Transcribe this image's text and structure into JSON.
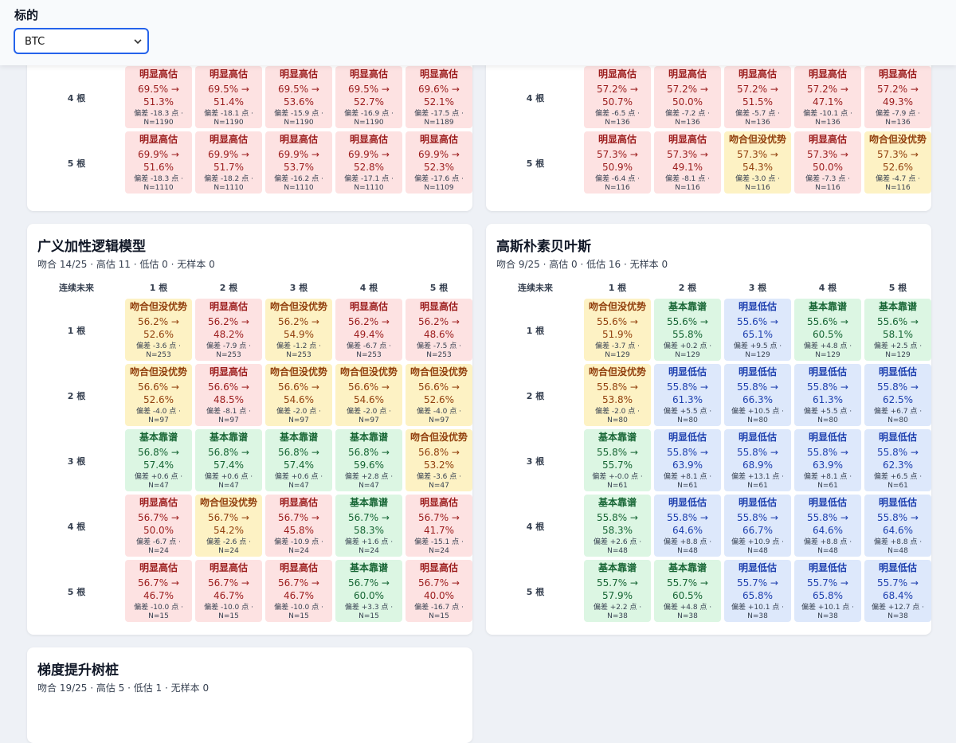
{
  "filter": {
    "label": "标的",
    "value": "BTC"
  },
  "cards": [
    {
      "title": "",
      "subtitle": "",
      "show_header": false,
      "col_header": "",
      "cols": [],
      "rows": [
        {
          "label": "4 根",
          "cells": [
            {
              "verdict": "明显高估",
              "a": "69.5% →",
              "b": "51.3%",
              "dev": "偏差 -18.3 点 ·",
              "n": "N=1190",
              "color": "red"
            },
            {
              "verdict": "明显高估",
              "a": "69.5% →",
              "b": "51.4%",
              "dev": "偏差 -18.1 点 ·",
              "n": "N=1190",
              "color": "red"
            },
            {
              "verdict": "明显高估",
              "a": "69.5% →",
              "b": "53.6%",
              "dev": "偏差 -15.9 点 ·",
              "n": "N=1190",
              "color": "red"
            },
            {
              "verdict": "明显高估",
              "a": "69.5% →",
              "b": "52.7%",
              "dev": "偏差 -16.9 点 ·",
              "n": "N=1190",
              "color": "red"
            },
            {
              "verdict": "明显高估",
              "a": "69.6% →",
              "b": "52.1%",
              "dev": "偏差 -17.5 点 ·",
              "n": "N=1189",
              "color": "red"
            }
          ]
        },
        {
          "label": "5 根",
          "cells": [
            {
              "verdict": "明显高估",
              "a": "69.9% →",
              "b": "51.6%",
              "dev": "偏差 -18.3 点 ·",
              "n": "N=1110",
              "color": "red"
            },
            {
              "verdict": "明显高估",
              "a": "69.9% →",
              "b": "51.7%",
              "dev": "偏差 -18.2 点 ·",
              "n": "N=1110",
              "color": "red"
            },
            {
              "verdict": "明显高估",
              "a": "69.9% →",
              "b": "53.7%",
              "dev": "偏差 -16.2 点 ·",
              "n": "N=1110",
              "color": "red"
            },
            {
              "verdict": "明显高估",
              "a": "69.9% →",
              "b": "52.8%",
              "dev": "偏差 -17.1 点 ·",
              "n": "N=1110",
              "color": "red"
            },
            {
              "verdict": "明显高估",
              "a": "69.9% →",
              "b": "52.3%",
              "dev": "偏差 -17.6 点 ·",
              "n": "N=1109",
              "color": "red"
            }
          ]
        }
      ]
    },
    {
      "title": "",
      "subtitle": "",
      "show_header": false,
      "col_header": "",
      "cols": [],
      "rows": [
        {
          "label": "4 根",
          "cells": [
            {
              "verdict": "明显高估",
              "a": "57.2% →",
              "b": "50.7%",
              "dev": "偏差 -6.5 点 ·",
              "n": "N=136",
              "color": "red"
            },
            {
              "verdict": "明显高估",
              "a": "57.2% →",
              "b": "50.0%",
              "dev": "偏差 -7.2 点 ·",
              "n": "N=136",
              "color": "red"
            },
            {
              "verdict": "明显高估",
              "a": "57.2% →",
              "b": "51.5%",
              "dev": "偏差 -5.7 点 ·",
              "n": "N=136",
              "color": "red"
            },
            {
              "verdict": "明显高估",
              "a": "57.2% →",
              "b": "47.1%",
              "dev": "偏差 -10.1 点 ·",
              "n": "N=136",
              "color": "red"
            },
            {
              "verdict": "明显高估",
              "a": "57.2% →",
              "b": "49.3%",
              "dev": "偏差 -7.9 点 ·",
              "n": "N=136",
              "color": "red"
            }
          ]
        },
        {
          "label": "5 根",
          "cells": [
            {
              "verdict": "明显高估",
              "a": "57.3% →",
              "b": "50.9%",
              "dev": "偏差 -6.4 点 ·",
              "n": "N=116",
              "color": "red"
            },
            {
              "verdict": "明显高估",
              "a": "57.3% →",
              "b": "49.1%",
              "dev": "偏差 -8.1 点 ·",
              "n": "N=116",
              "color": "red"
            },
            {
              "verdict": "吻合但没优势",
              "a": "57.3% →",
              "b": "54.3%",
              "dev": "偏差 -3.0 点 ·",
              "n": "N=116",
              "color": "yel"
            },
            {
              "verdict": "明显高估",
              "a": "57.3% →",
              "b": "50.0%",
              "dev": "偏差 -7.3 点 ·",
              "n": "N=116",
              "color": "red"
            },
            {
              "verdict": "吻合但没优势",
              "a": "57.3% →",
              "b": "52.6%",
              "dev": "偏差 -4.7 点 ·",
              "n": "N=116",
              "color": "yel"
            }
          ]
        }
      ]
    },
    {
      "title": "广义加性逻辑模型",
      "subtitle": "吻合 14/25 · 高估 11 · 低估 0 · 无样本 0",
      "show_header": true,
      "col_header": "连续未来",
      "cols": [
        "1 根",
        "2 根",
        "3 根",
        "4 根",
        "5 根"
      ],
      "rows": [
        {
          "label": "1 根",
          "cells": [
            {
              "verdict": "吻合但没优势",
              "a": "56.2% →",
              "b": "52.6%",
              "dev": "偏差 -3.6 点 ·",
              "n": "N=253",
              "color": "yel"
            },
            {
              "verdict": "明显高估",
              "a": "56.2% →",
              "b": "48.2%",
              "dev": "偏差 -7.9 点 ·",
              "n": "N=253",
              "color": "red"
            },
            {
              "verdict": "吻合但没优势",
              "a": "56.2% →",
              "b": "54.9%",
              "dev": "偏差 -1.2 点 ·",
              "n": "N=253",
              "color": "yel"
            },
            {
              "verdict": "明显高估",
              "a": "56.2% →",
              "b": "49.4%",
              "dev": "偏差 -6.7 点 ·",
              "n": "N=253",
              "color": "red"
            },
            {
              "verdict": "明显高估",
              "a": "56.2% →",
              "b": "48.6%",
              "dev": "偏差 -7.5 点 ·",
              "n": "N=253",
              "color": "red"
            }
          ]
        },
        {
          "label": "2 根",
          "cells": [
            {
              "verdict": "吻合但没优势",
              "a": "56.6% →",
              "b": "52.6%",
              "dev": "偏差 -4.0 点 ·",
              "n": "N=97",
              "color": "yel"
            },
            {
              "verdict": "明显高估",
              "a": "56.6% →",
              "b": "48.5%",
              "dev": "偏差 -8.1 点 ·",
              "n": "N=97",
              "color": "red"
            },
            {
              "verdict": "吻合但没优势",
              "a": "56.6% →",
              "b": "54.6%",
              "dev": "偏差 -2.0 点 ·",
              "n": "N=97",
              "color": "yel"
            },
            {
              "verdict": "吻合但没优势",
              "a": "56.6% →",
              "b": "54.6%",
              "dev": "偏差 -2.0 点 ·",
              "n": "N=97",
              "color": "yel"
            },
            {
              "verdict": "吻合但没优势",
              "a": "56.6% →",
              "b": "52.6%",
              "dev": "偏差 -4.0 点 ·",
              "n": "N=97",
              "color": "yel"
            }
          ]
        },
        {
          "label": "3 根",
          "cells": [
            {
              "verdict": "基本靠谱",
              "a": "56.8% →",
              "b": "57.4%",
              "dev": "偏差 +0.6 点 ·",
              "n": "N=47",
              "color": "grn"
            },
            {
              "verdict": "基本靠谱",
              "a": "56.8% →",
              "b": "57.4%",
              "dev": "偏差 +0.6 点 ·",
              "n": "N=47",
              "color": "grn"
            },
            {
              "verdict": "基本靠谱",
              "a": "56.8% →",
              "b": "57.4%",
              "dev": "偏差 +0.6 点 ·",
              "n": "N=47",
              "color": "grn"
            },
            {
              "verdict": "基本靠谱",
              "a": "56.8% →",
              "b": "59.6%",
              "dev": "偏差 +2.8 点 ·",
              "n": "N=47",
              "color": "grn"
            },
            {
              "verdict": "吻合但没优势",
              "a": "56.8% →",
              "b": "53.2%",
              "dev": "偏差 -3.6 点 ·",
              "n": "N=47",
              "color": "yel"
            }
          ]
        },
        {
          "label": "4 根",
          "cells": [
            {
              "verdict": "明显高估",
              "a": "56.7% →",
              "b": "50.0%",
              "dev": "偏差 -6.7 点 ·",
              "n": "N=24",
              "color": "red"
            },
            {
              "verdict": "吻合但没优势",
              "a": "56.7% →",
              "b": "54.2%",
              "dev": "偏差 -2.6 点 ·",
              "n": "N=24",
              "color": "yel"
            },
            {
              "verdict": "明显高估",
              "a": "56.7% →",
              "b": "45.8%",
              "dev": "偏差 -10.9 点 ·",
              "n": "N=24",
              "color": "red"
            },
            {
              "verdict": "基本靠谱",
              "a": "56.7% →",
              "b": "58.3%",
              "dev": "偏差 +1.6 点 ·",
              "n": "N=24",
              "color": "grn"
            },
            {
              "verdict": "明显高估",
              "a": "56.7% →",
              "b": "41.7%",
              "dev": "偏差 -15.1 点 ·",
              "n": "N=24",
              "color": "red"
            }
          ]
        },
        {
          "label": "5 根",
          "cells": [
            {
              "verdict": "明显高估",
              "a": "56.7% →",
              "b": "46.7%",
              "dev": "偏差 -10.0 点 ·",
              "n": "N=15",
              "color": "red"
            },
            {
              "verdict": "明显高估",
              "a": "56.7% →",
              "b": "46.7%",
              "dev": "偏差 -10.0 点 ·",
              "n": "N=15",
              "color": "red"
            },
            {
              "verdict": "明显高估",
              "a": "56.7% →",
              "b": "46.7%",
              "dev": "偏差 -10.0 点 ·",
              "n": "N=15",
              "color": "red"
            },
            {
              "verdict": "基本靠谱",
              "a": "56.7% →",
              "b": "60.0%",
              "dev": "偏差 +3.3 点 ·",
              "n": "N=15",
              "color": "grn"
            },
            {
              "verdict": "明显高估",
              "a": "56.7% →",
              "b": "40.0%",
              "dev": "偏差 -16.7 点 ·",
              "n": "N=15",
              "color": "red"
            }
          ]
        }
      ]
    },
    {
      "title": "高斯朴素贝叶斯",
      "subtitle": "吻合 9/25 · 高估 0 · 低估 16 · 无样本 0",
      "show_header": true,
      "col_header": "连续未来",
      "cols": [
        "1 根",
        "2 根",
        "3 根",
        "4 根",
        "5 根"
      ],
      "rows": [
        {
          "label": "1 根",
          "cells": [
            {
              "verdict": "吻合但没优势",
              "a": "55.6% →",
              "b": "51.9%",
              "dev": "偏差 -3.7 点 ·",
              "n": "N=129",
              "color": "yel"
            },
            {
              "verdict": "基本靠谱",
              "a": "55.6% →",
              "b": "55.8%",
              "dev": "偏差 +0.2 点 ·",
              "n": "N=129",
              "color": "grn"
            },
            {
              "verdict": "明显低估",
              "a": "55.6% →",
              "b": "65.1%",
              "dev": "偏差 +9.5 点 ·",
              "n": "N=129",
              "color": "blu"
            },
            {
              "verdict": "基本靠谱",
              "a": "55.6% →",
              "b": "60.5%",
              "dev": "偏差 +4.8 点 ·",
              "n": "N=129",
              "color": "grn"
            },
            {
              "verdict": "基本靠谱",
              "a": "55.6% →",
              "b": "58.1%",
              "dev": "偏差 +2.5 点 ·",
              "n": "N=129",
              "color": "grn"
            }
          ]
        },
        {
          "label": "2 根",
          "cells": [
            {
              "verdict": "吻合但没优势",
              "a": "55.8% →",
              "b": "53.8%",
              "dev": "偏差 -2.0 点 ·",
              "n": "N=80",
              "color": "yel"
            },
            {
              "verdict": "明显低估",
              "a": "55.8% →",
              "b": "61.3%",
              "dev": "偏差 +5.5 点 ·",
              "n": "N=80",
              "color": "blu"
            },
            {
              "verdict": "明显低估",
              "a": "55.8% →",
              "b": "66.3%",
              "dev": "偏差 +10.5 点 ·",
              "n": "N=80",
              "color": "blu"
            },
            {
              "verdict": "明显低估",
              "a": "55.8% →",
              "b": "61.3%",
              "dev": "偏差 +5.5 点 ·",
              "n": "N=80",
              "color": "blu"
            },
            {
              "verdict": "明显低估",
              "a": "55.8% →",
              "b": "62.5%",
              "dev": "偏差 +6.7 点 ·",
              "n": "N=80",
              "color": "blu"
            }
          ]
        },
        {
          "label": "3 根",
          "cells": [
            {
              "verdict": "基本靠谱",
              "a": "55.8% →",
              "b": "55.7%",
              "dev": "偏差 +-0.0 点 ·",
              "n": "N=61",
              "color": "grn"
            },
            {
              "verdict": "明显低估",
              "a": "55.8% →",
              "b": "63.9%",
              "dev": "偏差 +8.1 点 ·",
              "n": "N=61",
              "color": "blu"
            },
            {
              "verdict": "明显低估",
              "a": "55.8% →",
              "b": "68.9%",
              "dev": "偏差 +13.1 点 ·",
              "n": "N=61",
              "color": "blu"
            },
            {
              "verdict": "明显低估",
              "a": "55.8% →",
              "b": "63.9%",
              "dev": "偏差 +8.1 点 ·",
              "n": "N=61",
              "color": "blu"
            },
            {
              "verdict": "明显低估",
              "a": "55.8% →",
              "b": "62.3%",
              "dev": "偏差 +6.5 点 ·",
              "n": "N=61",
              "color": "blu"
            }
          ]
        },
        {
          "label": "4 根",
          "cells": [
            {
              "verdict": "基本靠谱",
              "a": "55.8% →",
              "b": "58.3%",
              "dev": "偏差 +2.6 点 ·",
              "n": "N=48",
              "color": "grn"
            },
            {
              "verdict": "明显低估",
              "a": "55.8% →",
              "b": "64.6%",
              "dev": "偏差 +8.8 点 ·",
              "n": "N=48",
              "color": "blu"
            },
            {
              "verdict": "明显低估",
              "a": "55.8% →",
              "b": "66.7%",
              "dev": "偏差 +10.9 点 ·",
              "n": "N=48",
              "color": "blu"
            },
            {
              "verdict": "明显低估",
              "a": "55.8% →",
              "b": "64.6%",
              "dev": "偏差 +8.8 点 ·",
              "n": "N=48",
              "color": "blu"
            },
            {
              "verdict": "明显低估",
              "a": "55.8% →",
              "b": "64.6%",
              "dev": "偏差 +8.8 点 ·",
              "n": "N=48",
              "color": "blu"
            }
          ]
        },
        {
          "label": "5 根",
          "cells": [
            {
              "verdict": "基本靠谱",
              "a": "55.7% →",
              "b": "57.9%",
              "dev": "偏差 +2.2 点 ·",
              "n": "N=38",
              "color": "grn"
            },
            {
              "verdict": "基本靠谱",
              "a": "55.7% →",
              "b": "60.5%",
              "dev": "偏差 +4.8 点 ·",
              "n": "N=38",
              "color": "grn"
            },
            {
              "verdict": "明显低估",
              "a": "55.7% →",
              "b": "65.8%",
              "dev": "偏差 +10.1 点 ·",
              "n": "N=38",
              "color": "blu"
            },
            {
              "verdict": "明显低估",
              "a": "55.7% →",
              "b": "65.8%",
              "dev": "偏差 +10.1 点 ·",
              "n": "N=38",
              "color": "blu"
            },
            {
              "verdict": "明显低估",
              "a": "55.7% →",
              "b": "68.4%",
              "dev": "偏差 +12.7 点 ·",
              "n": "N=38",
              "color": "blu"
            }
          ]
        }
      ]
    },
    {
      "title": "梯度提升树桩",
      "subtitle": "吻合 19/25 · 高估 5 · 低估 1 · 无样本 0",
      "show_header": false,
      "col_header": "",
      "cols": [],
      "rows": []
    }
  ]
}
